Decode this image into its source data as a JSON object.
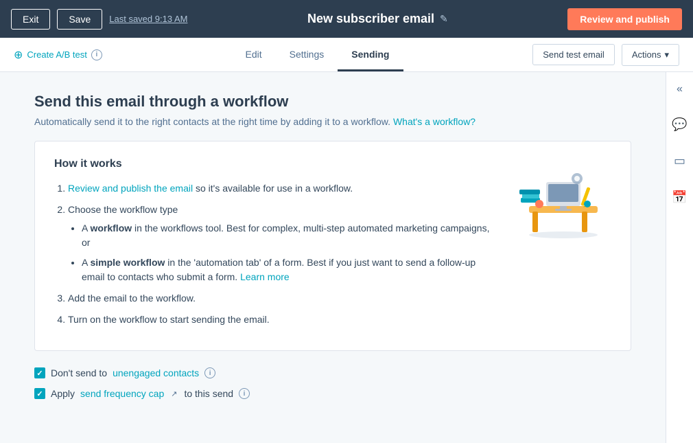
{
  "topbar": {
    "exit_label": "Exit",
    "save_label": "Save",
    "last_saved": "Last saved 9:13 AM",
    "page_title": "New subscriber email",
    "review_publish_label": "Review and publish"
  },
  "navbar": {
    "ab_test_label": "Create A/B test",
    "tabs": [
      {
        "id": "edit",
        "label": "Edit",
        "active": false
      },
      {
        "id": "settings",
        "label": "Settings",
        "active": false
      },
      {
        "id": "sending",
        "label": "Sending",
        "active": true
      }
    ],
    "send_test_label": "Send test email",
    "actions_label": "Actions"
  },
  "sidebar": {
    "icons": [
      "collapse",
      "chat",
      "card",
      "calendar"
    ]
  },
  "main": {
    "section_title": "Send this email through a workflow",
    "section_subtitle": "Automatically send it to the right contacts at the right time by adding it to a workflow.",
    "whats_workflow_label": "What's a workflow?",
    "how_it_works": {
      "title": "How it works",
      "steps": [
        {
          "text_prefix": "",
          "link": "Review and publish the email",
          "text_suffix": " so it's available for use in a workflow."
        },
        {
          "text": "Choose the workflow type",
          "sub_items": [
            {
              "text_prefix": "A ",
              "bold": "workflow",
              "text_suffix": " in the workflows tool. Best for complex, multi-step automated marketing campaigns, or"
            },
            {
              "text_prefix": "A ",
              "bold": "simple workflow",
              "text_suffix": " in the 'automation tab' of a form. Best if you just want to send a follow-up email to contacts who submit a form.",
              "link": "Learn more"
            }
          ]
        },
        {
          "text": "Add the email to the workflow."
        },
        {
          "text": "Turn on the workflow to start sending the email."
        }
      ]
    },
    "checkboxes": [
      {
        "label_prefix": "Don't send to ",
        "link": "unengaged contacts",
        "label_suffix": "",
        "has_info": true
      },
      {
        "label_prefix": "Apply ",
        "link": "send frequency cap",
        "label_suffix": " to this send",
        "has_external_link": true,
        "has_info": true
      }
    ]
  }
}
